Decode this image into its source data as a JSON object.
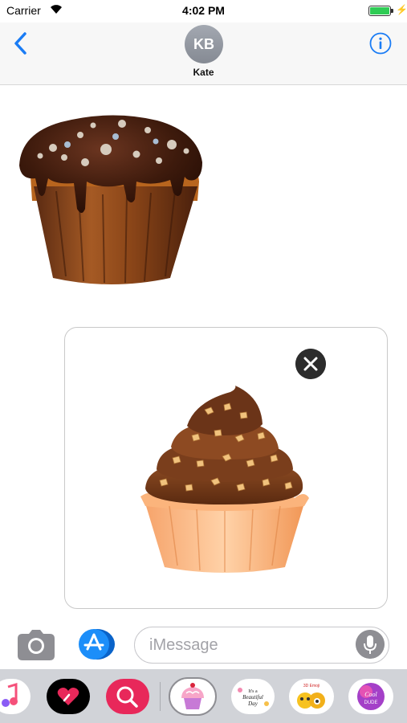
{
  "status_bar": {
    "carrier": "Carrier",
    "time": "4:02 PM",
    "battery_level": 1.0,
    "icons": [
      "wifi-icon",
      "battery-icon",
      "charging-bolt-icon"
    ]
  },
  "nav": {
    "back_icon": "chevron-left-icon",
    "avatar_initials": "KB",
    "contact_name": "Kate",
    "info_icon": "info-circle-icon"
  },
  "conversation": {
    "sent_sticker": "chocolate-drip-cupcake-sticker"
  },
  "compose": {
    "preview_sticker": "caramel-nut-cupcake-sticker",
    "remove_icon": "close-icon",
    "camera_icon": "camera-icon",
    "app_store_icon": "app-store-icon",
    "placeholder": "iMessage",
    "mic_icon": "microphone-icon"
  },
  "app_drawer": {
    "apps": [
      {
        "name": "Music",
        "icon": "music-app-icon"
      },
      {
        "name": "Digital Touch",
        "icon": "digital-touch-app-icon"
      },
      {
        "name": "Images",
        "icon": "image-search-app-icon"
      },
      {
        "name": "Cupcake Stickers",
        "icon": "cupcake-sticker-app-icon",
        "selected": true
      },
      {
        "name": "Beautiful Day",
        "icon": "beautiful-day-sticker-app-icon"
      },
      {
        "name": "3D Emoji",
        "icon": "emoji-sticker-app-icon"
      },
      {
        "name": "Cool Dude",
        "icon": "cool-dude-sticker-app-icon"
      }
    ],
    "beautiful_day_text": "It's a Beautiful Day",
    "emoji_text": "3D Emoji",
    "cool_dude_text": "Cool DUDE"
  },
  "colors": {
    "accent": "#1a7cf5",
    "app_store_blue": "#1c8ef9",
    "digital_touch": "#e8285a",
    "image_search": "#e8285a"
  }
}
